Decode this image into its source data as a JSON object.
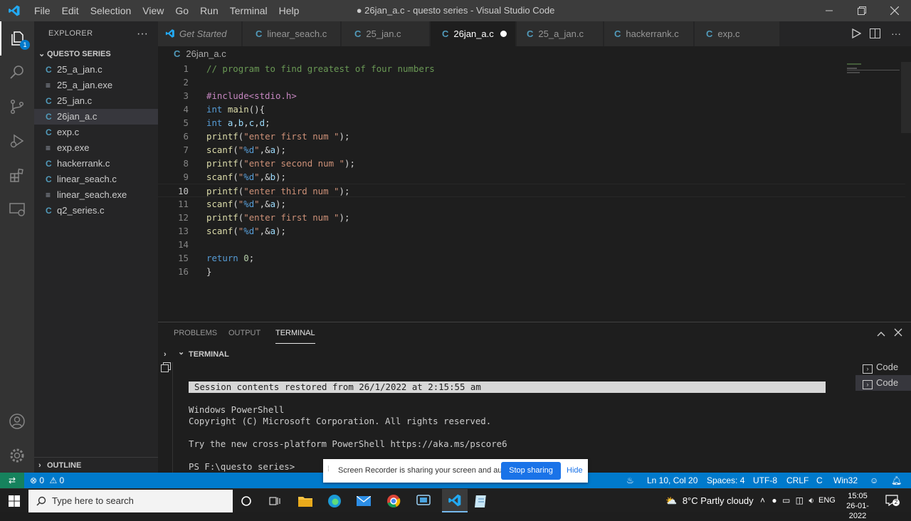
{
  "menu": [
    "File",
    "Edit",
    "Selection",
    "View",
    "Go",
    "Run",
    "Terminal",
    "Help"
  ],
  "window_title": "● 26jan_a.c - questo series - Visual Studio Code",
  "explorer": {
    "header": "EXPLORER",
    "dots": "···",
    "folder": "QUESTO SERIES",
    "files": [
      {
        "name": "25_a_jan.c",
        "type": "c"
      },
      {
        "name": "25_a_jan.exe",
        "type": "exe"
      },
      {
        "name": "25_jan.c",
        "type": "c"
      },
      {
        "name": "26jan_a.c",
        "type": "c",
        "selected": true
      },
      {
        "name": "exp.c",
        "type": "c"
      },
      {
        "name": "exp.exe",
        "type": "exe"
      },
      {
        "name": "hackerrank.c",
        "type": "c"
      },
      {
        "name": "linear_seach.c",
        "type": "c"
      },
      {
        "name": "linear_seach.exe",
        "type": "exe"
      },
      {
        "name": "q2_series.c",
        "type": "c"
      }
    ],
    "outline": "OUTLINE",
    "badge": "1"
  },
  "tabs": [
    {
      "label": "Get Started"
    },
    {
      "label": "linear_seach.c"
    },
    {
      "label": "25_jan.c"
    },
    {
      "label": "26jan_a.c",
      "active": true
    },
    {
      "label": "25_a_jan.c"
    },
    {
      "label": "hackerrank.c"
    },
    {
      "label": "exp.c"
    }
  ],
  "breadcrumb": "26jan_a.c",
  "editor": {
    "current_line": 10,
    "lines": [
      "// program to find greatest of four numbers",
      "",
      "#include<stdio.h>",
      "int main(){",
      "int a,b,c,d;",
      "printf(\"enter first num \");",
      "scanf(\"%d\",&a);",
      "printf(\"enter second num \");",
      "scanf(\"%d\",&b);",
      "printf(\"enter third num \");",
      "scanf(\"%d\",&a);",
      "printf(\"enter first num \");",
      "scanf(\"%d\",&a);",
      "",
      "return 0;",
      "}"
    ]
  },
  "panel": {
    "tabs": [
      "PROBLEMS",
      "OUTPUT",
      "TERMINAL"
    ],
    "active_tab": "TERMINAL",
    "terminal_header": "TERMINAL",
    "session_banner": "Session contents restored from 26/1/2022 at 2:15:55 am",
    "output_lines": [
      "Windows PowerShell",
      "Copyright (C) Microsoft Corporation. All rights reserved.",
      "",
      "Try the new cross-platform PowerShell https://aka.ms/pscore6",
      "",
      "PS F:\\questo series>"
    ],
    "terminal_list": [
      "Code",
      "Code"
    ]
  },
  "statusbar": {
    "errors": "0",
    "warnings": "0",
    "position": "Ln 10, Col 20",
    "spaces": "Spaces: 4",
    "encoding": "UTF-8",
    "eol": "CRLF",
    "language": "C",
    "platform": "Win32"
  },
  "share_notice": {
    "text": "Screen Recorder is sharing your screen and audio.",
    "stop": "Stop sharing",
    "hide": "Hide"
  },
  "taskbar": {
    "search_placeholder": "Type here to search",
    "weather": "8°C  Partly cloudy",
    "lang": "ENG",
    "time": "15:05",
    "date": "26-01-2022",
    "notif": "2"
  },
  "colors": {
    "accent": "#007acc",
    "titlebar": "#3c3c3c",
    "editor_bg": "#1e1e1e",
    "sidebar_bg": "#252526"
  }
}
